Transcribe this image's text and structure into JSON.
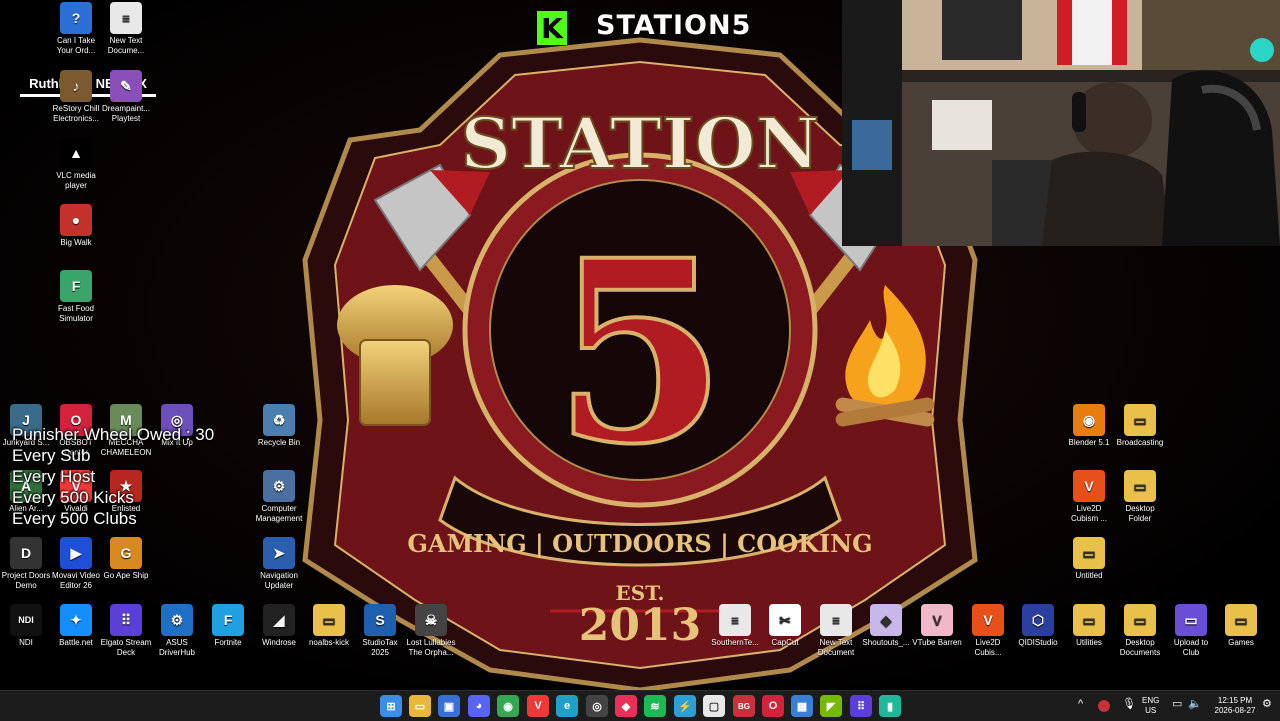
{
  "stream": {
    "channel_name": "STATION5",
    "kick_logo_letter": "K",
    "now_playing": "Ruthless - NEFFEX",
    "overlay_lines": [
      "Punisher Wheel Owed : 30",
      "Every Sub",
      "Every Host",
      "Every 500 Kicks",
      "Every 500 Clubs"
    ]
  },
  "wallpaper": {
    "title": "STATION",
    "number": "5",
    "tagline": "GAMING | OUTDOORS | COOKING",
    "est": "EST.",
    "year": "2013"
  },
  "desktop": {
    "icons": [
      {
        "label": "Can I Take Your Ord...",
        "icon": "game-icon",
        "color": "#2b6fd6",
        "glyph": "?"
      },
      {
        "label": "New Text Docume...",
        "icon": "text-document-icon",
        "color": "#e8e8e8",
        "glyph": "≡"
      },
      {
        "label": "ReStory Chill Electronics...",
        "icon": "music-icon",
        "color": "#7a5a2e",
        "glyph": "♪"
      },
      {
        "label": "Dreampaint... Playtest",
        "icon": "game-icon",
        "color": "#8a4fb8",
        "glyph": "✎"
      },
      {
        "label": "VLC media player",
        "icon": "vlc-icon",
        "color": "#000000",
        "glyph": "▲"
      },
      {
        "label": "Big Walk",
        "icon": "game-icon",
        "color": "#c4302b",
        "glyph": "●"
      },
      {
        "label": "Fast Food Simulator",
        "icon": "game-icon",
        "color": "#3aa56a",
        "glyph": "F"
      },
      {
        "label": "Junkyard S...",
        "icon": "game-icon",
        "color": "#3b6b8a",
        "glyph": "J"
      },
      {
        "label": "OBSBOT Center",
        "icon": "obsbot-icon",
        "color": "#d4213c",
        "glyph": "O"
      },
      {
        "label": "MECCHA CHAMELEON",
        "icon": "game-icon",
        "color": "#6a8a5a",
        "glyph": "M"
      },
      {
        "label": "Mix It Up",
        "icon": "fingerprint-icon",
        "color": "#6d4fb8",
        "glyph": "◎"
      },
      {
        "label": "Recycle Bin",
        "icon": "recycle-bin-icon",
        "color": "#4a7fb0",
        "glyph": "♻"
      },
      {
        "label": "Alien Ar...",
        "icon": "game-icon",
        "color": "#2f6e3a",
        "glyph": "A"
      },
      {
        "label": "Vivaldi",
        "icon": "vivaldi-icon",
        "color": "#ef3939",
        "glyph": "V"
      },
      {
        "label": "Enlisted",
        "icon": "game-icon",
        "color": "#b5271f",
        "glyph": "★"
      },
      {
        "label": "Computer Management",
        "icon": "computer-management-icon",
        "color": "#4a6fa0",
        "glyph": "⚙"
      },
      {
        "label": "Project Doors Demo",
        "icon": "game-icon",
        "color": "#333333",
        "glyph": "D"
      },
      {
        "label": "Movavi Video Editor 26",
        "icon": "movavi-icon",
        "color": "#1f4fd6",
        "glyph": "▶"
      },
      {
        "label": "Go Ape Ship",
        "icon": "game-icon",
        "color": "#d68a1f",
        "glyph": "G"
      },
      {
        "label": "Navigation Updater",
        "icon": "navigation-icon",
        "color": "#2a5fb0",
        "glyph": "➤"
      },
      {
        "label": "Blender 5.1",
        "icon": "blender-icon",
        "color": "#e87d0d",
        "glyph": "◉"
      },
      {
        "label": "Broadcasting",
        "icon": "folder-icon",
        "color": "#e8c04a",
        "glyph": "▭"
      },
      {
        "label": "Live2D Cubism ...",
        "icon": "live2d-icon",
        "color": "#e8501a",
        "glyph": "V"
      },
      {
        "label": "Desktop Folder",
        "icon": "folder-icon",
        "color": "#e8c04a",
        "glyph": "▭"
      },
      {
        "label": "Untitled",
        "icon": "folder-icon",
        "color": "#e8c04a",
        "glyph": "▭"
      },
      {
        "label": "NDI",
        "icon": "ndi-icon",
        "color": "#111111",
        "glyph": "NDI"
      },
      {
        "label": "Battle.net",
        "icon": "battlenet-icon",
        "color": "#148eff",
        "glyph": "✦"
      },
      {
        "label": "Elgato Stream Deck",
        "icon": "stream-deck-icon",
        "color": "#5b3fd6",
        "glyph": "⠿"
      },
      {
        "label": "ASUS DriverHub",
        "icon": "gear-icon",
        "color": "#1f6fc4",
        "glyph": "⚙"
      },
      {
        "label": "Fortnite",
        "icon": "fortnite-icon",
        "color": "#1fa0e0",
        "glyph": "F"
      },
      {
        "label": "Windrose",
        "icon": "game-icon",
        "color": "#222222",
        "glyph": "◢"
      },
      {
        "label": "noalbs-kick",
        "icon": "folder-icon",
        "color": "#e8c04a",
        "glyph": "▭"
      },
      {
        "label": "StudioTax 2025",
        "icon": "studiotax-icon",
        "color": "#1f5fb0",
        "glyph": "S"
      },
      {
        "label": "Lost Lullabies The Orpha...",
        "icon": "game-icon",
        "color": "#444444",
        "glyph": "☠"
      },
      {
        "label": "SouthernTe...",
        "icon": "text-document-icon",
        "color": "#e8e8e8",
        "glyph": "≡"
      },
      {
        "label": "CapCut",
        "icon": "capcut-icon",
        "color": "#ffffff",
        "glyph": "✂"
      },
      {
        "label": "New Text Document",
        "icon": "text-document-icon",
        "color": "#e8e8e8",
        "glyph": "≡"
      },
      {
        "label": "Shoutouts_...",
        "icon": "file-icon",
        "color": "#c8b8e8",
        "glyph": "◈"
      },
      {
        "label": "VTube Barren",
        "icon": "game-icon",
        "color": "#f0b8c8",
        "glyph": "V"
      },
      {
        "label": "Live2D Cubis...",
        "icon": "live2d-icon",
        "color": "#e8501a",
        "glyph": "V"
      },
      {
        "label": "QIDIStudio",
        "icon": "qidi-icon",
        "color": "#2a3fa0",
        "glyph": "⬡"
      },
      {
        "label": "Utilities",
        "icon": "folder-icon",
        "color": "#e8c04a",
        "glyph": "▭"
      },
      {
        "label": "Desktop Documents",
        "icon": "folder-icon",
        "color": "#e8c04a",
        "glyph": "▭"
      },
      {
        "label": "Upload to Club",
        "icon": "folder-icon",
        "color": "#6a4fd6",
        "glyph": "▭"
      },
      {
        "label": "Games",
        "icon": "folder-icon",
        "color": "#e8c04a",
        "glyph": "▭"
      }
    ]
  },
  "taskbar": {
    "apps": [
      {
        "name": "start-button",
        "color": "#3a8ee6",
        "glyph": "⊞"
      },
      {
        "name": "file-explorer-icon",
        "color": "#e8b83a",
        "glyph": "▭"
      },
      {
        "name": "store-icon",
        "color": "#3a6fd6",
        "glyph": "▣"
      },
      {
        "name": "discord-icon",
        "color": "#5865f2",
        "glyph": "◕"
      },
      {
        "name": "chrome-icon",
        "color": "#34a853",
        "glyph": "◉"
      },
      {
        "name": "vivaldi-icon",
        "color": "#ef3939",
        "glyph": "V"
      },
      {
        "name": "edge-icon",
        "color": "#1fa0c8",
        "glyph": "e"
      },
      {
        "name": "obs-icon",
        "color": "#444444",
        "glyph": "◎"
      },
      {
        "name": "app-icon",
        "color": "#e8305a",
        "glyph": "◆"
      },
      {
        "name": "spotify-icon",
        "color": "#1db954",
        "glyph": "≋"
      },
      {
        "name": "app-icon",
        "color": "#2aa0d6",
        "glyph": "⚡"
      },
      {
        "name": "app-icon",
        "color": "#e8e8e8",
        "glyph": "▢"
      },
      {
        "name": "bg-app-icon",
        "color": "#c8303a",
        "glyph": "BG"
      },
      {
        "name": "obsbot-icon",
        "color": "#d4213c",
        "glyph": "O"
      },
      {
        "name": "app-icon",
        "color": "#3a7fd6",
        "glyph": "▦"
      },
      {
        "name": "nvidia-icon",
        "color": "#76b900",
        "glyph": "◤"
      },
      {
        "name": "stream-deck-icon",
        "color": "#5b3fd6",
        "glyph": "⠿"
      },
      {
        "name": "app-icon",
        "color": "#1fb89a",
        "glyph": "▮"
      }
    ],
    "tray": {
      "chevron": "^",
      "lang_top": "ENG",
      "lang_bottom": "US",
      "time": "12:15 PM",
      "date": "2026-08-27"
    }
  }
}
